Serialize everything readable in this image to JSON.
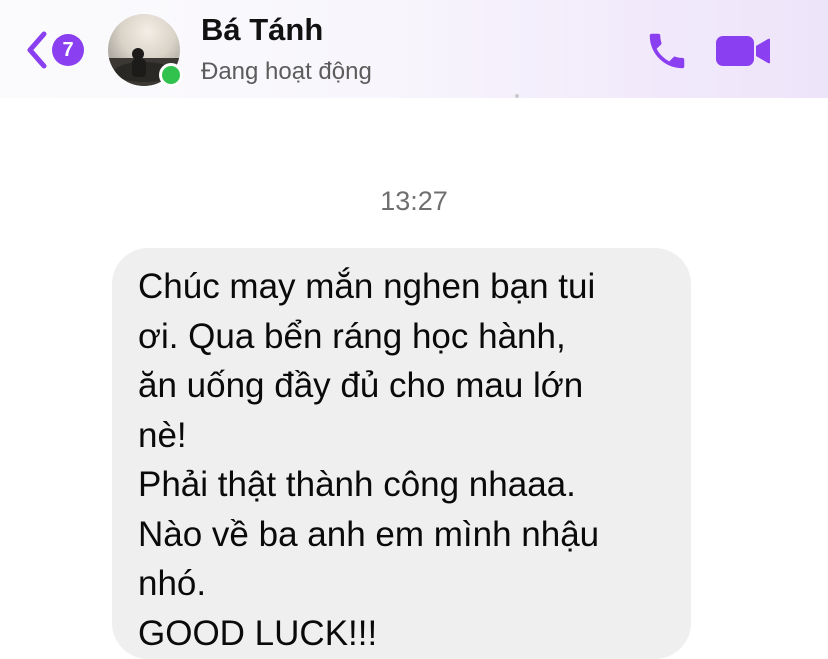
{
  "header": {
    "unread_count": "7",
    "contact_name": "Bá Tánh",
    "status": "Đang hoạt động",
    "accent_color": "#8a3ff0",
    "presence_color": "#31c24d"
  },
  "icons": {
    "back": "chevron-left-icon",
    "call": "phone-icon",
    "video": "video-camera-icon"
  },
  "conversation": {
    "timestamp": "13:27",
    "message": {
      "lines": [
        "Chúc may mắn nghen bạn tui",
        "ơi. Qua bển ráng học hành,",
        "ăn uống đầy đủ cho mau lớn",
        "nè!",
        "Phải thật thành công nhaaa.",
        "Nào về ba anh em mình nhậu",
        "nhó.",
        "GOOD LUCK!!!"
      ]
    }
  }
}
